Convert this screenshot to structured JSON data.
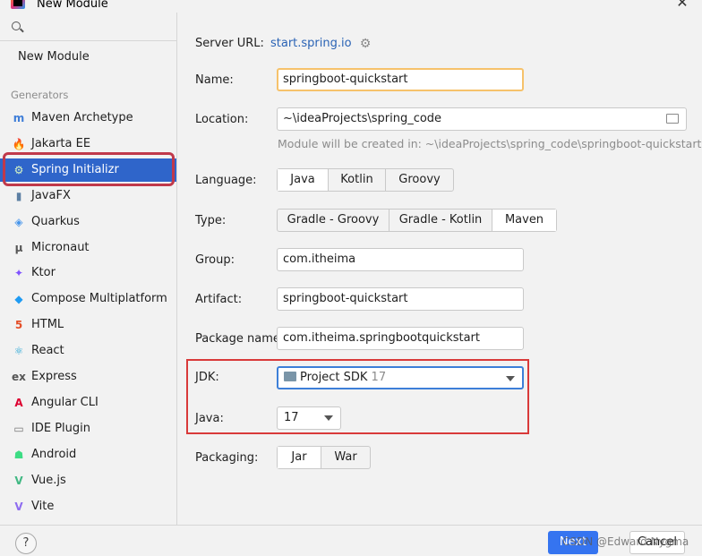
{
  "window": {
    "title": "New Module"
  },
  "sidebar": {
    "search_placeholder": "",
    "new_module": "New Module",
    "generators_label": "Generators",
    "items": [
      {
        "label": "Maven Archetype",
        "icon": "maven-icon",
        "glyph": "m",
        "color": "#3f7ed8"
      },
      {
        "label": "Jakarta EE",
        "icon": "jakarta-icon",
        "glyph": "🔥",
        "color": "#f4a623"
      },
      {
        "label": "Spring Initializr",
        "icon": "spring-icon",
        "glyph": "⚙",
        "color": "#6db33f"
      },
      {
        "label": "JavaFX",
        "icon": "javafx-icon",
        "glyph": "▮",
        "color": "#5c7fa3"
      },
      {
        "label": "Quarkus",
        "icon": "quarkus-icon",
        "glyph": "◈",
        "color": "#4695eb"
      },
      {
        "label": "Micronaut",
        "icon": "micronaut-icon",
        "glyph": "μ",
        "color": "#555555"
      },
      {
        "label": "Ktor",
        "icon": "ktor-icon",
        "glyph": "✦",
        "color": "#7f52ff"
      },
      {
        "label": "Compose Multiplatform",
        "icon": "compose-icon",
        "glyph": "◆",
        "color": "#1f9bf3"
      },
      {
        "label": "HTML",
        "icon": "html-icon",
        "glyph": "5",
        "color": "#e44d26"
      },
      {
        "label": "React",
        "icon": "react-icon",
        "glyph": "⚛",
        "color": "#2aa7d6"
      },
      {
        "label": "Express",
        "icon": "express-icon",
        "glyph": "ex",
        "color": "#555555"
      },
      {
        "label": "Angular CLI",
        "icon": "angular-icon",
        "glyph": "A",
        "color": "#dd0031"
      },
      {
        "label": "IDE Plugin",
        "icon": "ide-plugin-icon",
        "glyph": "▭",
        "color": "#777777"
      },
      {
        "label": "Android",
        "icon": "android-icon",
        "glyph": "☗",
        "color": "#3ddc84"
      },
      {
        "label": "Vue.js",
        "icon": "vue-icon",
        "glyph": "V",
        "color": "#41b883"
      },
      {
        "label": "Vite",
        "icon": "vite-icon",
        "glyph": "V",
        "color": "#8e6cf0"
      }
    ],
    "selected_index": 2
  },
  "form": {
    "server_url_label": "Server URL:",
    "server_url": "start.spring.io",
    "name_label": "Name:",
    "name": "springboot-quickstart",
    "location_label": "Location:",
    "location": "~\\ideaProjects\\spring_code",
    "location_hint": "Module will be created in: ~\\ideaProjects\\spring_code\\springboot-quickstart",
    "language_label": "Language:",
    "languages": [
      "Java",
      "Kotlin",
      "Groovy"
    ],
    "type_label": "Type:",
    "types": [
      "Gradle - Groovy",
      "Gradle - Kotlin",
      "Maven"
    ],
    "group_label": "Group:",
    "group": "com.itheima",
    "artifact_label": "Artifact:",
    "artifact": "springboot-quickstart",
    "package_label": "Package name:",
    "package_name": "com.itheima.springbootquickstart",
    "jdk_label": "JDK:",
    "jdk_value": "Project SDK",
    "jdk_version": "17",
    "java_label": "Java:",
    "java_version": "17",
    "packaging_label": "Packaging:",
    "packagings": [
      "Jar",
      "War"
    ]
  },
  "footer": {
    "help": "?",
    "next": "Next",
    "cancel": "Cancel",
    "watermark": "CSDN @Edward Nygma"
  }
}
